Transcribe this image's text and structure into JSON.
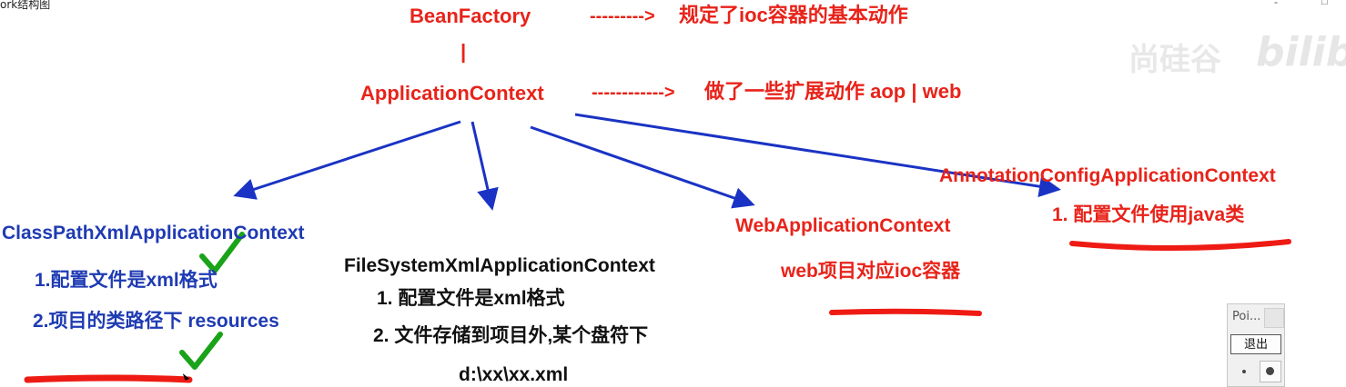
{
  "window": {
    "title": "ork结构图"
  },
  "diagram": {
    "bean_factory": {
      "label": "BeanFactory",
      "arrow": "--------->",
      "desc": "规定了ioc容器的基本动作"
    },
    "connector_bar": "|",
    "application_context": {
      "label": "ApplicationContext",
      "arrow": "------------>",
      "desc": "做了一些扩展动作 aop  | web"
    },
    "classpath": {
      "title": "ClassPathXmlApplicationContext",
      "items": [
        "1.配置文件是xml格式",
        "2.项目的类路径下 resources"
      ]
    },
    "filesystem": {
      "title": "FileSystemXmlApplicationContext",
      "items": [
        "1. 配置文件是xml格式",
        "2. 文件存储到项目外,某个盘符下",
        "d:\\xx\\xx.xml"
      ]
    },
    "web": {
      "title": "WebApplicationContext",
      "items": [
        "web项目对应ioc容器"
      ]
    },
    "annotation": {
      "title": "AnnotationConfigApplicationContext",
      "items": [
        "1. 配置文件使用java类"
      ]
    },
    "colors": {
      "heading": "#e8231a",
      "blue_text": "#1f3bb3",
      "arrow": "#1a33c4",
      "check": "#1aa31a",
      "underline": "#ee1b14"
    }
  },
  "watermark": {
    "text": "尚硅谷",
    "logo": "bilibili"
  },
  "pointer_panel": {
    "title": "Poi...",
    "exit_label": "退出"
  },
  "icons": [
    "checkmark-icon",
    "checkmark-icon",
    "mouse-cursor-icon",
    "dot-icon",
    "dot-icon"
  ]
}
